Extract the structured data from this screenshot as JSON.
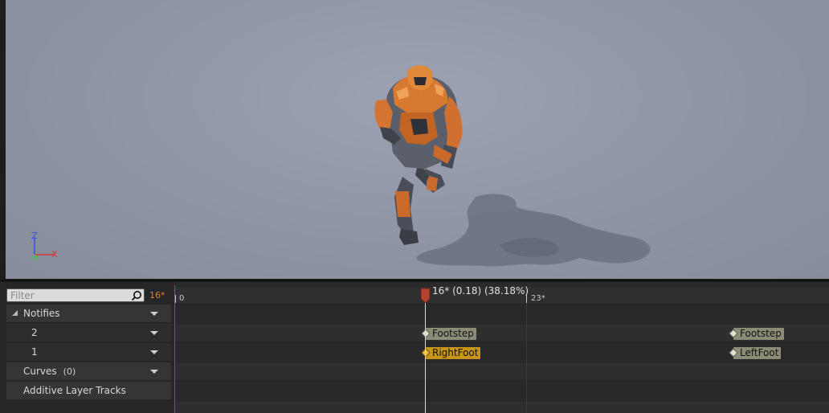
{
  "viewport": {
    "axis": {
      "z": "Z",
      "y": "Y",
      "x": "X"
    }
  },
  "filter": {
    "placeholder": "Filter",
    "frame": "16*"
  },
  "tracks": {
    "notifies": {
      "label": "Notifies"
    },
    "rows": [
      {
        "label": "2"
      },
      {
        "label": "1"
      }
    ],
    "curves": {
      "label": "Curves",
      "count": "(0)"
    },
    "additive": {
      "label": "Additive Layer Tracks"
    }
  },
  "timeline": {
    "start_label": "0",
    "end_label": "23*",
    "playhead_label": "16* (0.18) (38.18%)"
  },
  "notifies": [
    {
      "label": "Footstep",
      "selected": false
    },
    {
      "label": "RightFoot",
      "selected": true
    },
    {
      "label": "Footstep",
      "selected": false
    },
    {
      "label": "LeftFoot",
      "selected": false
    }
  ]
}
